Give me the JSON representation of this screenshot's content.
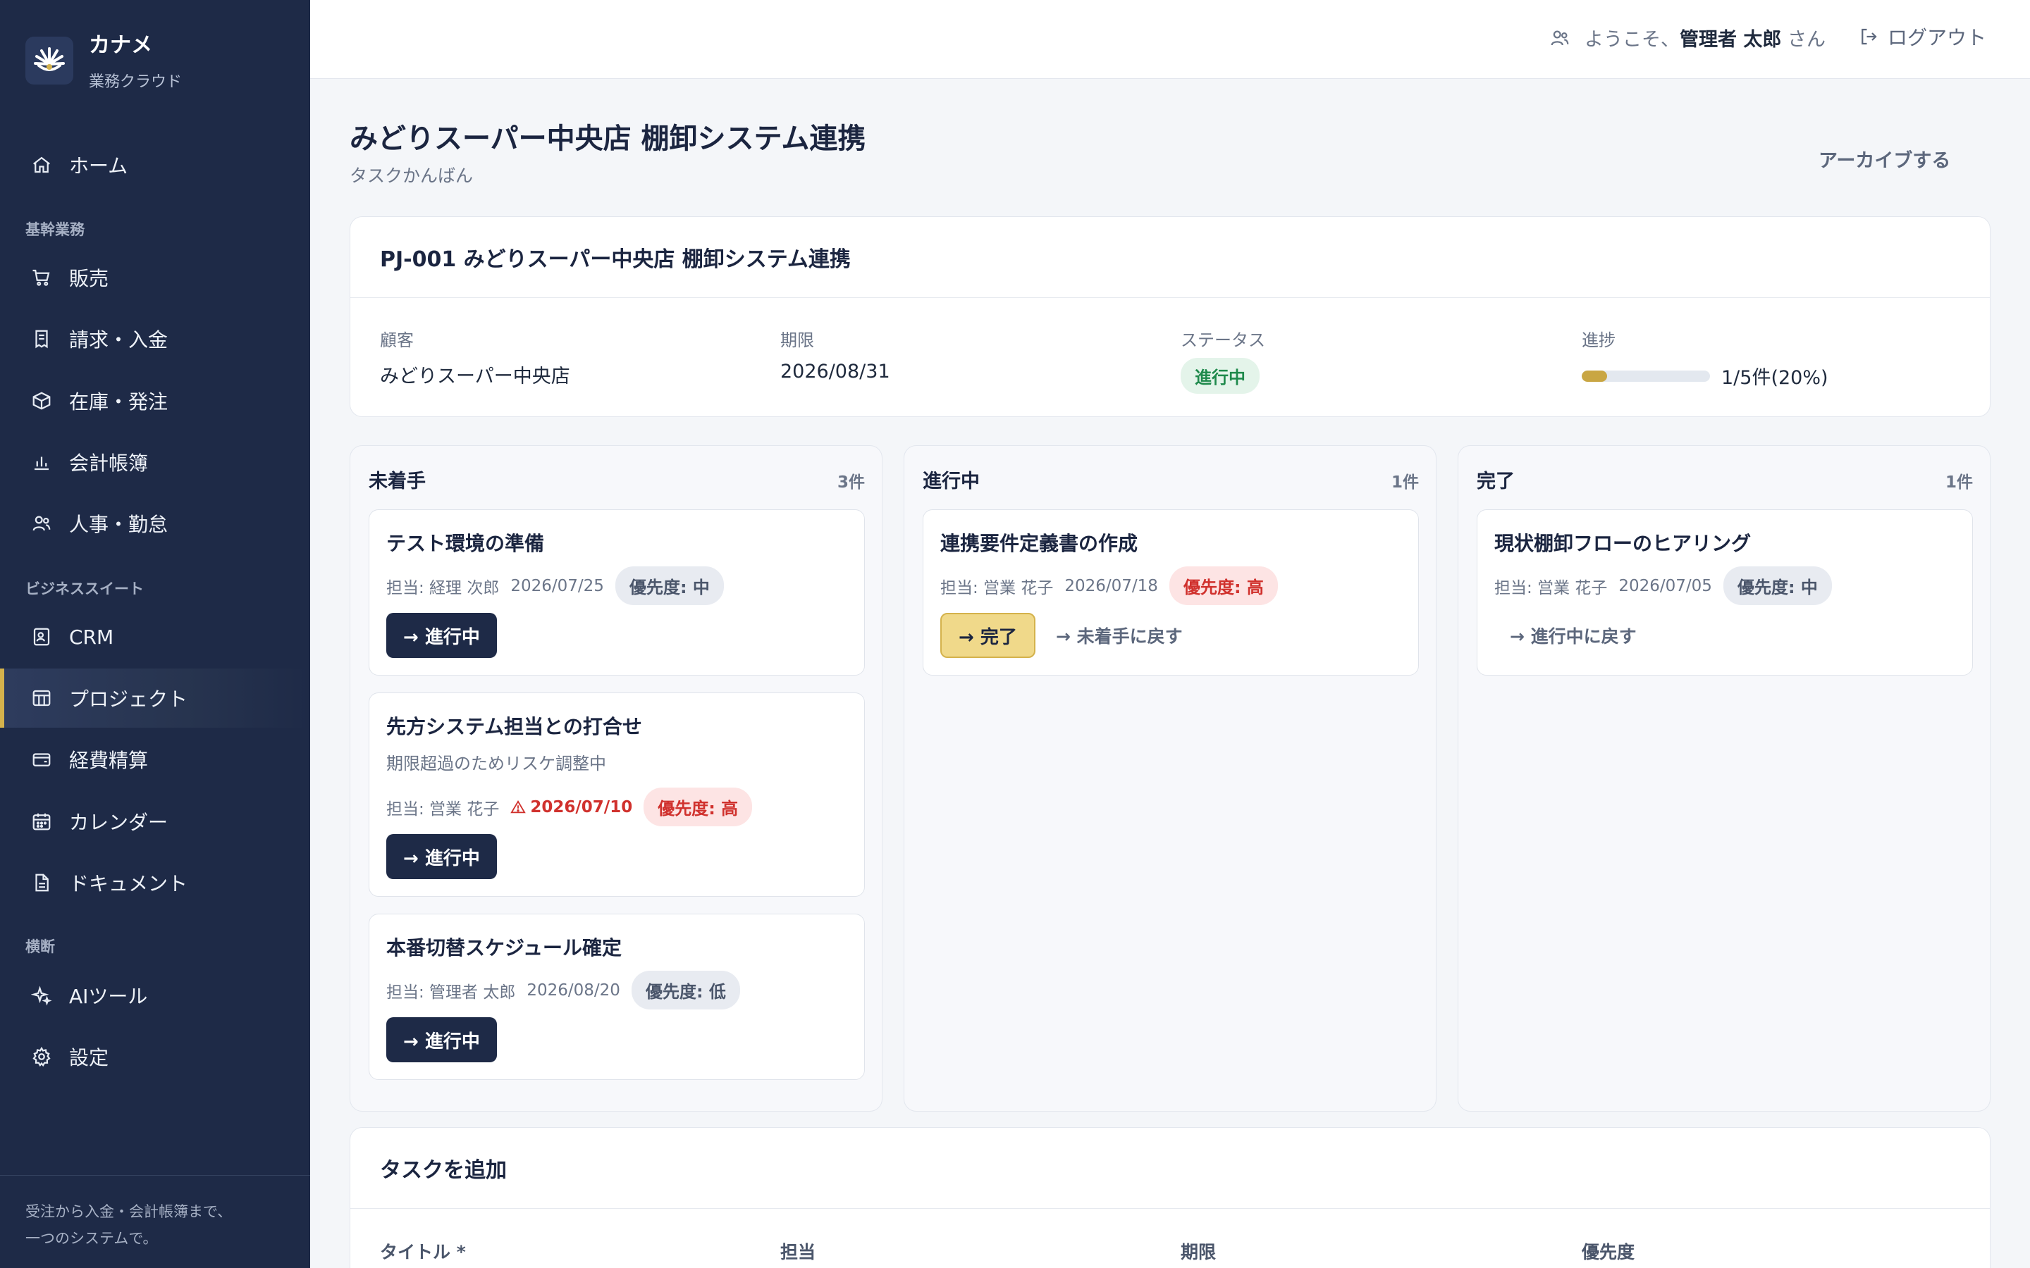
{
  "brand": {
    "name": "カナメ",
    "sub": "業務クラウド"
  },
  "sidebar": {
    "home": "ホーム",
    "section_core": "基幹業務",
    "sales": "販売",
    "billing": "請求・入金",
    "inventory": "在庫・発注",
    "accounting": "会計帳簿",
    "hr": "人事・勤怠",
    "section_suite": "ビジネススイート",
    "crm": "CRM",
    "project": "プロジェクト",
    "expense": "経費精算",
    "calendar": "カレンダー",
    "docs": "ドキュメント",
    "section_cross": "横断",
    "ai": "AIツール",
    "settings": "設定",
    "footer_line1": "受注から入金・会計帳簿まで、",
    "footer_line2": "一つのシステムで。",
    "active_color": "#d4b24c"
  },
  "header": {
    "welcome_prefix": "ようこそ、",
    "user_name": "管理者 太郎",
    "welcome_suffix": " さん",
    "logout": "ログアウト"
  },
  "page": {
    "title": "みどりスーパー中央店 棚卸システム連携",
    "subtitle": "タスクかんばん",
    "archive": "アーカイブする"
  },
  "project": {
    "heading": "PJ-001 みどりスーパー中央店 棚卸システム連携",
    "customer_label": "顧客",
    "customer": "みどりスーパー中央店",
    "due_label": "期限",
    "due": "2026/08/31",
    "status_label": "ステータス",
    "status": "進行中",
    "progress_label": "進捗",
    "progress_text": "1/5件(20%)",
    "progress_fraction": 0.2
  },
  "columns": [
    {
      "title": "未着手",
      "count": "3件",
      "tasks": [
        {
          "title": "テスト環境の準備",
          "assignee": "担当: 経理 次郎",
          "due": "2026/07/25",
          "priority": "優先度: 中",
          "action": "→ 進行中"
        },
        {
          "title": "先方システム担当との打合せ",
          "note": "期限超過のためリスケ調整中",
          "assignee": "担当: 営業 花子",
          "due": "2026/07/10",
          "priority": "優先度: 高",
          "action": "→ 進行中"
        },
        {
          "title": "本番切替スケジュール確定",
          "assignee": "担当: 管理者 太郎",
          "due": "2026/08/20",
          "priority": "優先度: 低",
          "action": "→ 進行中"
        }
      ]
    },
    {
      "title": "進行中",
      "count": "1件",
      "tasks": [
        {
          "title": "連携要件定義書の作成",
          "assignee": "担当: 営業 花子",
          "due": "2026/07/18",
          "priority": "優先度: 高",
          "action": "→ 完了",
          "back": "→ 未着手に戻す"
        }
      ]
    },
    {
      "title": "完了",
      "count": "1件",
      "tasks": [
        {
          "title": "現状棚卸フローのヒアリング",
          "assignee": "担当: 営業 花子",
          "due": "2026/07/05",
          "priority": "優先度: 中",
          "back": "→ 進行中に戻す"
        }
      ]
    }
  ],
  "add_task": {
    "heading": "タスクを追加",
    "title_label": "タイトル *",
    "assignee_label": "担当",
    "due_label": "期限",
    "priority_label": "優先度"
  }
}
